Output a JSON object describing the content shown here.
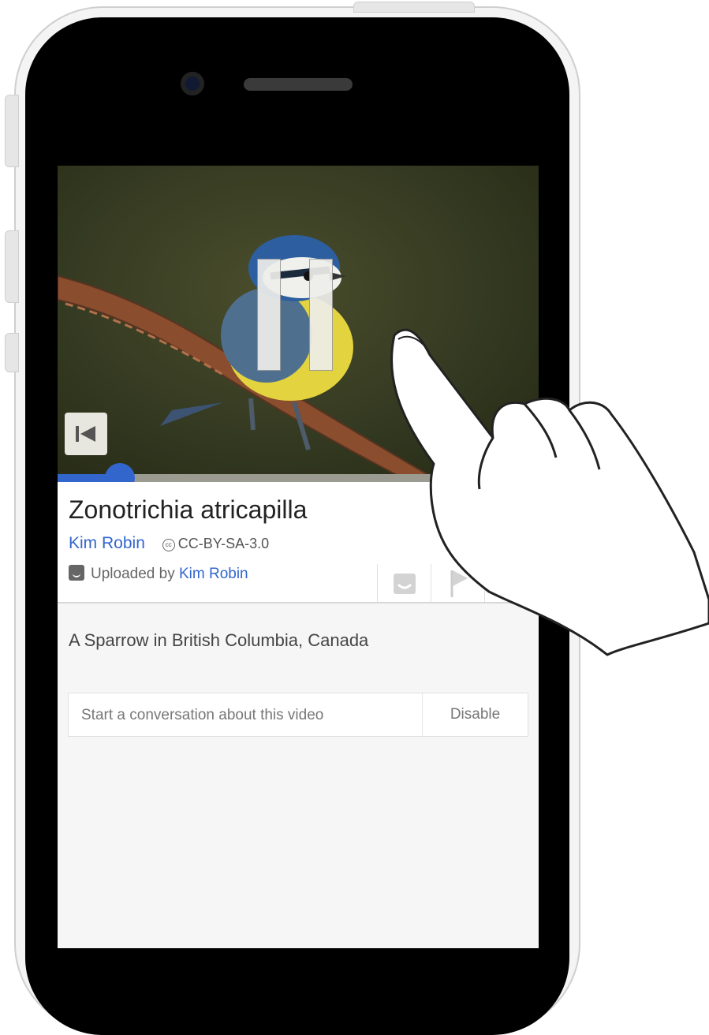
{
  "video": {
    "title": "Zonotrichia atricapilla",
    "author": "Kim Robin",
    "license": "CC-BY-SA-3.0",
    "cc_icon_text": "cc",
    "uploaded_by_prefix": "Uploaded by ",
    "uploader": "Kim Robin",
    "description": "A Sparrow in British Columbia, Canada",
    "progress": 0.13,
    "state_icon": "pause-icon"
  },
  "comments": {
    "placeholder": "Start a conversation about this video",
    "disable_label": "Disable"
  },
  "actions": [
    "uploader-icon",
    "flag-icon",
    "more-icon"
  ],
  "icons": [
    "skip-back-icon",
    "pause-icon",
    "cc-icon",
    "uploader-icon",
    "flag-icon"
  ],
  "colors": {
    "accent": "#3366cc",
    "background": "#f6f6f6",
    "phone": "#000000"
  }
}
